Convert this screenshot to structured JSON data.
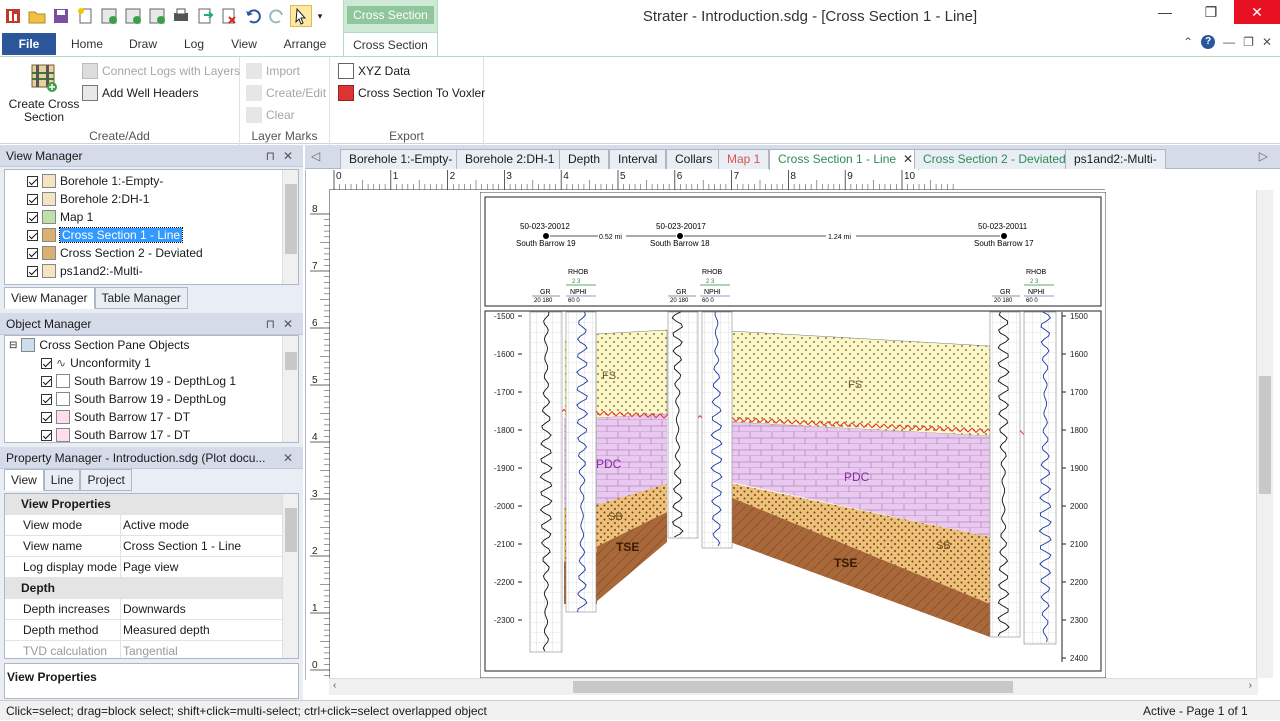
{
  "window": {
    "title": "Strater - Introduction.sdg - [Cross Section 1 - Line]",
    "context_group": "Cross Section"
  },
  "ribbon": {
    "tabs": [
      "File",
      "Home",
      "Draw",
      "Log",
      "View",
      "Arrange",
      "Cross Section"
    ],
    "groups": {
      "create_add": {
        "label": "Create/Add",
        "create_cross_section": "Create Cross\nSection",
        "connect_logs": "Connect Logs with Layers",
        "add_well_headers": "Add Well Headers"
      },
      "layer_marks": {
        "label": "Layer Marks",
        "import": "Import",
        "create_edit": "Create/Edit",
        "clear": "Clear"
      },
      "export": {
        "label": "Export",
        "xyz_data": "XYZ Data",
        "to_voxler": "Cross Section To Voxler"
      }
    }
  },
  "view_manager": {
    "title": "View Manager",
    "items": [
      {
        "label": "Borehole 1:-Empty-",
        "selected": false
      },
      {
        "label": "Borehole 2:DH-1",
        "selected": false
      },
      {
        "label": "Map 1",
        "selected": false
      },
      {
        "label": "Cross Section 1 - Line",
        "selected": true
      },
      {
        "label": "Cross Section 2 - Deviated",
        "selected": false
      },
      {
        "label": "ps1and2:-Multi-",
        "selected": false
      }
    ],
    "tabs": [
      "View Manager",
      "Table Manager"
    ]
  },
  "object_manager": {
    "title": "Object Manager",
    "root": "Cross Section Pane Objects",
    "items": [
      "Unconformity 1",
      "South Barrow 19 - DepthLog 1",
      "South Barrow 19 - DepthLog",
      "South Barrow 17 - DT",
      "South Barrow 17 - DT"
    ]
  },
  "property_manager": {
    "title": "Property Manager - Introduction.sdg (Plot docu...",
    "tabs": [
      "View",
      "Line",
      "Project"
    ],
    "rows": [
      {
        "type": "cat",
        "key": "View Properties"
      },
      {
        "key": "View mode",
        "value": "Active mode"
      },
      {
        "key": "View name",
        "value": "Cross Section 1 - Line"
      },
      {
        "key": "Log display mode",
        "value": "Page view"
      },
      {
        "type": "cat",
        "key": "Depth"
      },
      {
        "key": "Depth increases",
        "value": "Downwards"
      },
      {
        "key": "Depth method",
        "value": "Measured depth"
      },
      {
        "key": "TVD calculation ...",
        "value": "Tangential",
        "dim": true
      }
    ],
    "footer": "View Properties"
  },
  "doc_tabs": [
    {
      "label": "Borehole 1:-Empty-"
    },
    {
      "label": "Borehole 2:DH-1"
    },
    {
      "label": "Depth"
    },
    {
      "label": "Interval"
    },
    {
      "label": "Collars"
    },
    {
      "label": "Map 1"
    },
    {
      "label": "Cross Section 1 - Line"
    },
    {
      "label": "Cross Section 2 - Deviated"
    },
    {
      "label": "ps1and2:-Multi-"
    }
  ],
  "rulers": {
    "h_ticks": [
      "0",
      "1",
      "2",
      "3",
      "4",
      "5",
      "6",
      "7",
      "8",
      "9",
      "10"
    ],
    "v_ticks": [
      "8",
      "7",
      "6",
      "5",
      "4",
      "3",
      "2",
      "1",
      "0"
    ]
  },
  "section": {
    "wells": [
      {
        "id": "50-023-20012",
        "name": "South Barrow 19"
      },
      {
        "id": "50-023-20017",
        "name": "South Barrow 18"
      },
      {
        "id": "50-023-20011",
        "name": "South Barrow 17"
      }
    ],
    "distances": [
      "0.52 mi",
      "1.24 mi"
    ],
    "log_labels": {
      "rhob": "RHOB",
      "gr": "GR",
      "nphi": "NPHI",
      "gr_scale": "20 180",
      "rhob_scale": "2 3",
      "nphi_scale": "60 0"
    },
    "left_depths": [
      "-1500",
      "-1600",
      "-1700",
      "-1800",
      "-1900",
      "-2000",
      "-2100",
      "-2200",
      "-2300"
    ],
    "right_depths": [
      "1500",
      "1600",
      "1700",
      "1800",
      "1900",
      "2000",
      "2100",
      "2200",
      "2300",
      "2400"
    ],
    "layers": [
      "FS",
      "FS",
      "PDC",
      "PDC",
      "SB",
      "SB",
      "TSE",
      "TSE"
    ]
  },
  "status": {
    "left": "Click=select; drag=block select; shift+click=multi-select; ctrl+click=select overlapped object",
    "right": "Active - Page 1 of 1"
  }
}
